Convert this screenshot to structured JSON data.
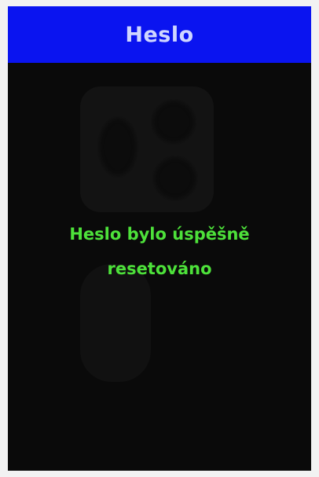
{
  "header": {
    "title": "Heslo"
  },
  "message": {
    "line1": "Heslo bylo úspěšně",
    "line2": "resetováno"
  },
  "colors": {
    "title_bar": "#0a14f0",
    "title_text": "#cfd6ff",
    "message_text": "#4de13a",
    "screen_background": "#0a0a0a"
  }
}
